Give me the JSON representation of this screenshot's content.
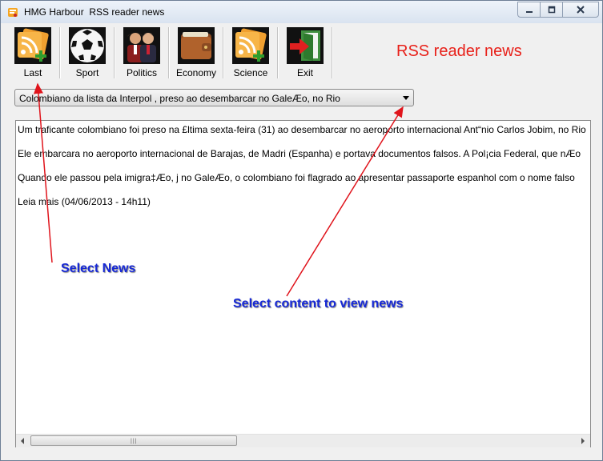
{
  "window": {
    "title": "HMG Harbour  RSS reader news"
  },
  "toolbar": {
    "items": [
      {
        "label": "Last",
        "icon": "rss-add-icon"
      },
      {
        "label": "Sport",
        "icon": "soccer-ball-icon"
      },
      {
        "label": "Politics",
        "icon": "politicians-icon"
      },
      {
        "label": "Economy",
        "icon": "wallet-icon"
      },
      {
        "label": "Science",
        "icon": "rss-science-icon"
      },
      {
        "label": "Exit",
        "icon": "exit-door-icon"
      }
    ]
  },
  "heading": "RSS reader news",
  "news_select": {
    "selected": "Colombiano da lista da Interpol , preso ao desembarcar no GaleÆo, no Rio"
  },
  "content": {
    "lines": [
      "Um traficante colombiano foi preso na £ltima sexta-feira (31) ao desembarcar no aeroporto internacional Ant“nio Carlos Jobim, no Rio",
      "Ele embarcara no aeroporto internacional de Barajas, de Madri (Espanha) e portava documentos falsos. A Pol¡cia Federal, que nÆo",
      "Quando ele passou pela imigra‡Æo, j  no GaleÆo, o colombiano foi flagrado ao apresentar passaporte espanhol com o nome falso",
      "Leia mais (04/06/2013 - 14h11)"
    ]
  },
  "annotations": {
    "select_news": "Select News",
    "select_content": "Select content to view news"
  },
  "colors": {
    "heading": "#e8211a",
    "annotation": "#1628d6",
    "arrow": "#e0141c"
  }
}
